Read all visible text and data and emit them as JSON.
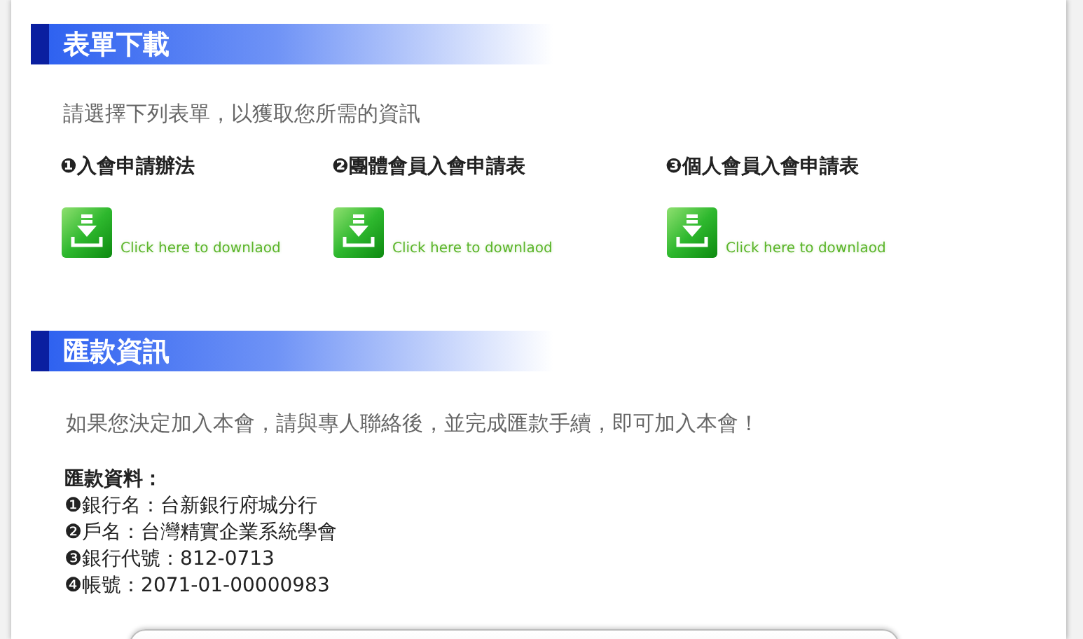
{
  "sections": [
    {
      "kind": "downloads",
      "title": "表單下載",
      "intro": "請選擇下列表單，以獲取您所需的資訊",
      "forms": [
        {
          "label": "❶入會申請辦法",
          "link": "Click here to downlaod"
        },
        {
          "label": "❷團體會員入會申請表",
          "link": "Click here to downlaod"
        },
        {
          "label": "❸個人會員入會申請表",
          "link": "Click here to downlaod"
        }
      ]
    },
    {
      "kind": "payment",
      "title": "匯款資訊",
      "intro": "如果您決定加入本會，請與專人聯絡後，並完成匯款手續，即可加入本會！",
      "heading": "匯款資料：",
      "lines": [
        "❶銀行名：台新銀行府城分行",
        "❷戶名：台灣精實企業系統學會",
        "❸銀行代號：812-0713",
        "❹帳號：2071-01-00000983"
      ]
    }
  ]
}
